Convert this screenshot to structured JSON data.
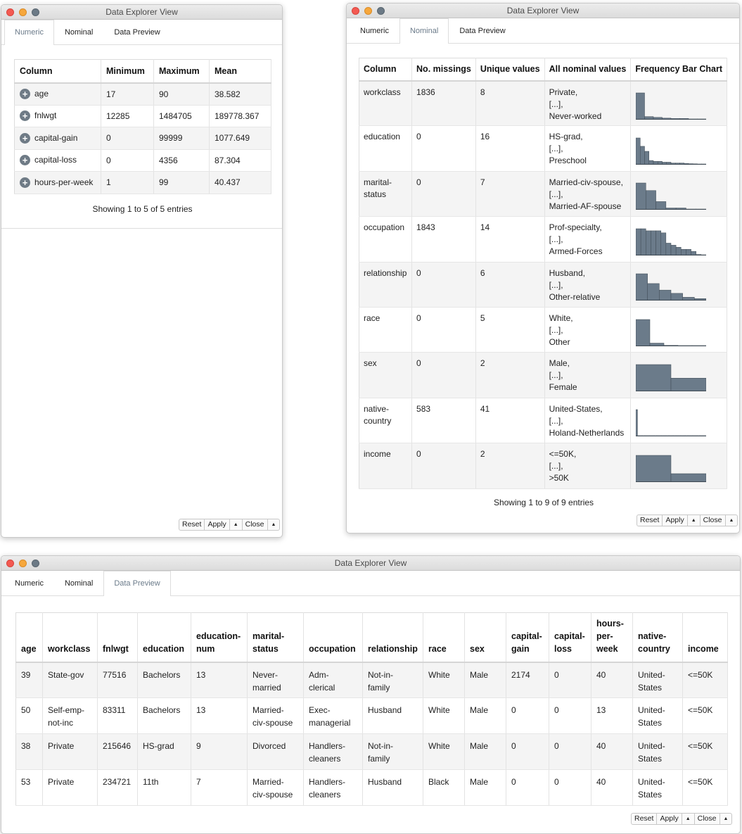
{
  "window_title": "Data Explorer View",
  "tabs": [
    "Numeric",
    "Nominal",
    "Data Preview"
  ],
  "buttons": {
    "reset": "Reset",
    "apply": "Apply",
    "close": "Close",
    "caret": "▲"
  },
  "colors": {
    "bar_fill": "#6b7b8a",
    "tab_active_text": "#6b7b8a"
  },
  "numeric": {
    "headers": [
      "Column",
      "Minimum",
      "Maximum",
      "Mean"
    ],
    "rows": [
      {
        "column": "age",
        "min": "17",
        "max": "90",
        "mean": "38.582"
      },
      {
        "column": "fnlwgt",
        "min": "12285",
        "max": "1484705",
        "mean": "189778.367"
      },
      {
        "column": "capital-gain",
        "min": "0",
        "max": "99999",
        "mean": "1077.649"
      },
      {
        "column": "capital-loss",
        "min": "0",
        "max": "4356",
        "mean": "87.304"
      },
      {
        "column": "hours-per-week",
        "min": "1",
        "max": "99",
        "mean": "40.437"
      }
    ],
    "entries": "Showing 1 to 5 of 5 entries"
  },
  "nominal": {
    "headers": [
      "Column",
      "No. missings",
      "Unique values",
      "All nominal values",
      "Frequency Bar Chart"
    ],
    "rows": [
      {
        "column": "workclass",
        "missings": "1836",
        "unique": "8",
        "values": [
          "Private,",
          "[...],",
          "Never-worked"
        ],
        "freq": [
          0.7,
          0.08,
          0.06,
          0.04,
          0.03,
          0.03,
          0.01,
          0.005
        ]
      },
      {
        "column": "education",
        "missings": "0",
        "unique": "16",
        "values": [
          "HS-grad,",
          "[...],",
          "Preschool"
        ],
        "freq": [
          0.32,
          0.22,
          0.16,
          0.05,
          0.04,
          0.04,
          0.03,
          0.03,
          0.02,
          0.02,
          0.02,
          0.015,
          0.012,
          0.01,
          0.008,
          0.004
        ]
      },
      {
        "column": "marital-status",
        "missings": "0",
        "unique": "7",
        "values": [
          "Married-civ-spouse,",
          "[...],",
          "Married-AF-spouse"
        ],
        "freq": [
          0.46,
          0.33,
          0.14,
          0.03,
          0.03,
          0.01,
          0.005
        ]
      },
      {
        "column": "occupation",
        "missings": "1843",
        "unique": "14",
        "values": [
          "Prof-specialty,",
          "[...],",
          "Armed-Forces"
        ],
        "freq": [
          0.13,
          0.13,
          0.12,
          0.12,
          0.12,
          0.11,
          0.06,
          0.05,
          0.04,
          0.03,
          0.03,
          0.02,
          0.005,
          0.002
        ]
      },
      {
        "column": "relationship",
        "missings": "0",
        "unique": "6",
        "values": [
          "Husband,",
          "[...],",
          "Other-relative"
        ],
        "freq": [
          0.41,
          0.26,
          0.16,
          0.11,
          0.05,
          0.03
        ]
      },
      {
        "column": "race",
        "missings": "0",
        "unique": "5",
        "values": [
          "White,",
          "[...],",
          "Other"
        ],
        "freq": [
          0.85,
          0.1,
          0.03,
          0.01,
          0.008
        ]
      },
      {
        "column": "sex",
        "missings": "0",
        "unique": "2",
        "values": [
          "Male,",
          "[...],",
          "Female"
        ],
        "freq": [
          0.67,
          0.33
        ]
      },
      {
        "column": "native-country",
        "missings": "583",
        "unique": "41",
        "values": [
          "United-States,",
          "[...],",
          "Holand-Netherlands"
        ],
        "freq": [
          0.91,
          0.02,
          0.01,
          0.01,
          0.005,
          0.005,
          0.005,
          0.005,
          0.004,
          0.004,
          0.003,
          0.003,
          0.003,
          0.003,
          0.002,
          0.002,
          0.002,
          0.002,
          0.002,
          0.002,
          0.002,
          0.002,
          0.001,
          0.001,
          0.001,
          0.001,
          0.001,
          0.001,
          0.001,
          0.001,
          0.001,
          0.001,
          0.001,
          0.001,
          0.001,
          0.001,
          0.001,
          0.001,
          0.001,
          0.001,
          0.0005
        ]
      },
      {
        "column": "income",
        "missings": "0",
        "unique": "2",
        "values": [
          "<=50K,",
          "[...],",
          ">50K"
        ],
        "freq": [
          0.76,
          0.24
        ]
      }
    ],
    "entries": "Showing 1 to 9 of 9 entries"
  },
  "preview": {
    "headers": [
      "age",
      "workclass",
      "fnlwgt",
      "education",
      "education-num",
      "marital-status",
      "occupation",
      "relationship",
      "race",
      "sex",
      "capital-gain",
      "capital-loss",
      "hours-per-week",
      "native-country",
      "income"
    ],
    "header_lines": [
      [
        "age"
      ],
      [
        "workclass"
      ],
      [
        "fnlwgt"
      ],
      [
        "education"
      ],
      [
        "education-",
        "num"
      ],
      [
        "marital-",
        "status"
      ],
      [
        "occupation"
      ],
      [
        "relationship"
      ],
      [
        "race"
      ],
      [
        "sex"
      ],
      [
        "capital-",
        "gain"
      ],
      [
        "capital-",
        "loss"
      ],
      [
        "hours-",
        "per-",
        "week"
      ],
      [
        "native-",
        "country"
      ],
      [
        "income"
      ]
    ],
    "rows": [
      [
        [
          "39"
        ],
        [
          "State-gov"
        ],
        [
          "77516"
        ],
        [
          "Bachelors"
        ],
        [
          "13"
        ],
        [
          "Never-",
          "married"
        ],
        [
          "Adm-",
          "clerical"
        ],
        [
          "Not-in-",
          "family"
        ],
        [
          "White"
        ],
        [
          "Male"
        ],
        [
          "2174"
        ],
        [
          "0"
        ],
        [
          "40"
        ],
        [
          "United-",
          "States"
        ],
        [
          "<=50K"
        ]
      ],
      [
        [
          "50"
        ],
        [
          "Self-emp-",
          "not-inc"
        ],
        [
          "83311"
        ],
        [
          "Bachelors"
        ],
        [
          "13"
        ],
        [
          "Married-",
          "civ-spouse"
        ],
        [
          "Exec-",
          "managerial"
        ],
        [
          "Husband"
        ],
        [
          "White"
        ],
        [
          "Male"
        ],
        [
          "0"
        ],
        [
          "0"
        ],
        [
          "13"
        ],
        [
          "United-",
          "States"
        ],
        [
          "<=50K"
        ]
      ],
      [
        [
          "38"
        ],
        [
          "Private"
        ],
        [
          "215646"
        ],
        [
          "HS-grad"
        ],
        [
          "9"
        ],
        [
          "Divorced"
        ],
        [
          "Handlers-",
          "cleaners"
        ],
        [
          "Not-in-",
          "family"
        ],
        [
          "White"
        ],
        [
          "Male"
        ],
        [
          "0"
        ],
        [
          "0"
        ],
        [
          "40"
        ],
        [
          "United-",
          "States"
        ],
        [
          "<=50K"
        ]
      ],
      [
        [
          "53"
        ],
        [
          "Private"
        ],
        [
          "234721"
        ],
        [
          "11th"
        ],
        [
          "7"
        ],
        [
          "Married-",
          "civ-spouse"
        ],
        [
          "Handlers-",
          "cleaners"
        ],
        [
          "Husband"
        ],
        [
          "Black"
        ],
        [
          "Male"
        ],
        [
          "0"
        ],
        [
          "0"
        ],
        [
          "40"
        ],
        [
          "United-",
          "States"
        ],
        [
          "<=50K"
        ]
      ]
    ]
  }
}
